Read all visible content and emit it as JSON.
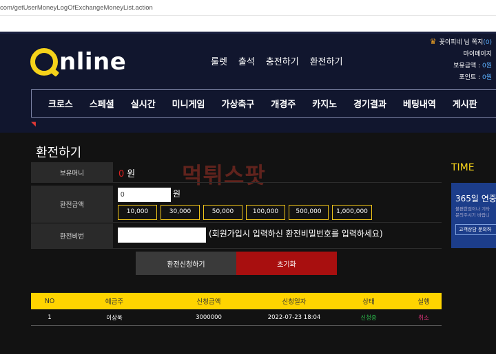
{
  "browser": {
    "url": "com/getUserMoneyLogOfExchangeMoneyList.action"
  },
  "header": {
    "logo_text": "nline",
    "top_menu": [
      "룰렛",
      "출석",
      "충전하기",
      "환전하기"
    ],
    "user": {
      "greeting": "꽃이피네 님 쪽지",
      "messages": "(0)",
      "mypage": "마이페이지",
      "balance_label": "보유금액 :",
      "balance_value": "0원",
      "point_label": "포인트 :",
      "point_value": "0원"
    },
    "nav": [
      "크로스",
      "스페셜",
      "실시간",
      "미니게임",
      "가상축구",
      "개경주",
      "카지노",
      "경기결과",
      "베팅내역",
      "게시판"
    ]
  },
  "page": {
    "title": "환전하기",
    "watermark": "먹튀스팟",
    "form": {
      "balance_label": "보유머니",
      "balance_value": "0",
      "balance_unit": "원",
      "amount_label": "환전금액",
      "amount_value": "0",
      "amount_unit": "원",
      "quick_amounts": [
        "10,000",
        "30,000",
        "50,000",
        "100,000",
        "500,000",
        "1,000,000"
      ],
      "password_label": "환전비번",
      "password_note": "(회원가입시 입력하신 환전비밀번호를 입력하세요)"
    },
    "buttons": {
      "apply": "환전신청하기",
      "reset": "초기화"
    },
    "table": {
      "headers": [
        "NO",
        "예금주",
        "신청금액",
        "신청일자",
        "상태",
        "실행"
      ],
      "rows": [
        {
          "no": "1",
          "holder": "이상욱",
          "amount": "3000000",
          "date": "2022-07-23 18:04",
          "status": "신청중",
          "action": "취소"
        }
      ]
    }
  },
  "sidebar": {
    "time_label": "TIME",
    "banner_title": "365일 연중",
    "banner_line1": "불편한점이나 기타",
    "banner_line2": "문의주시기 바랍니",
    "banner_button": "고객상담 문의하"
  },
  "colors": {
    "accent_yellow": "#ffd400",
    "reset_red": "#a80f0f",
    "status_green": "#2bb34a",
    "cancel_pink": "#e0357b"
  }
}
